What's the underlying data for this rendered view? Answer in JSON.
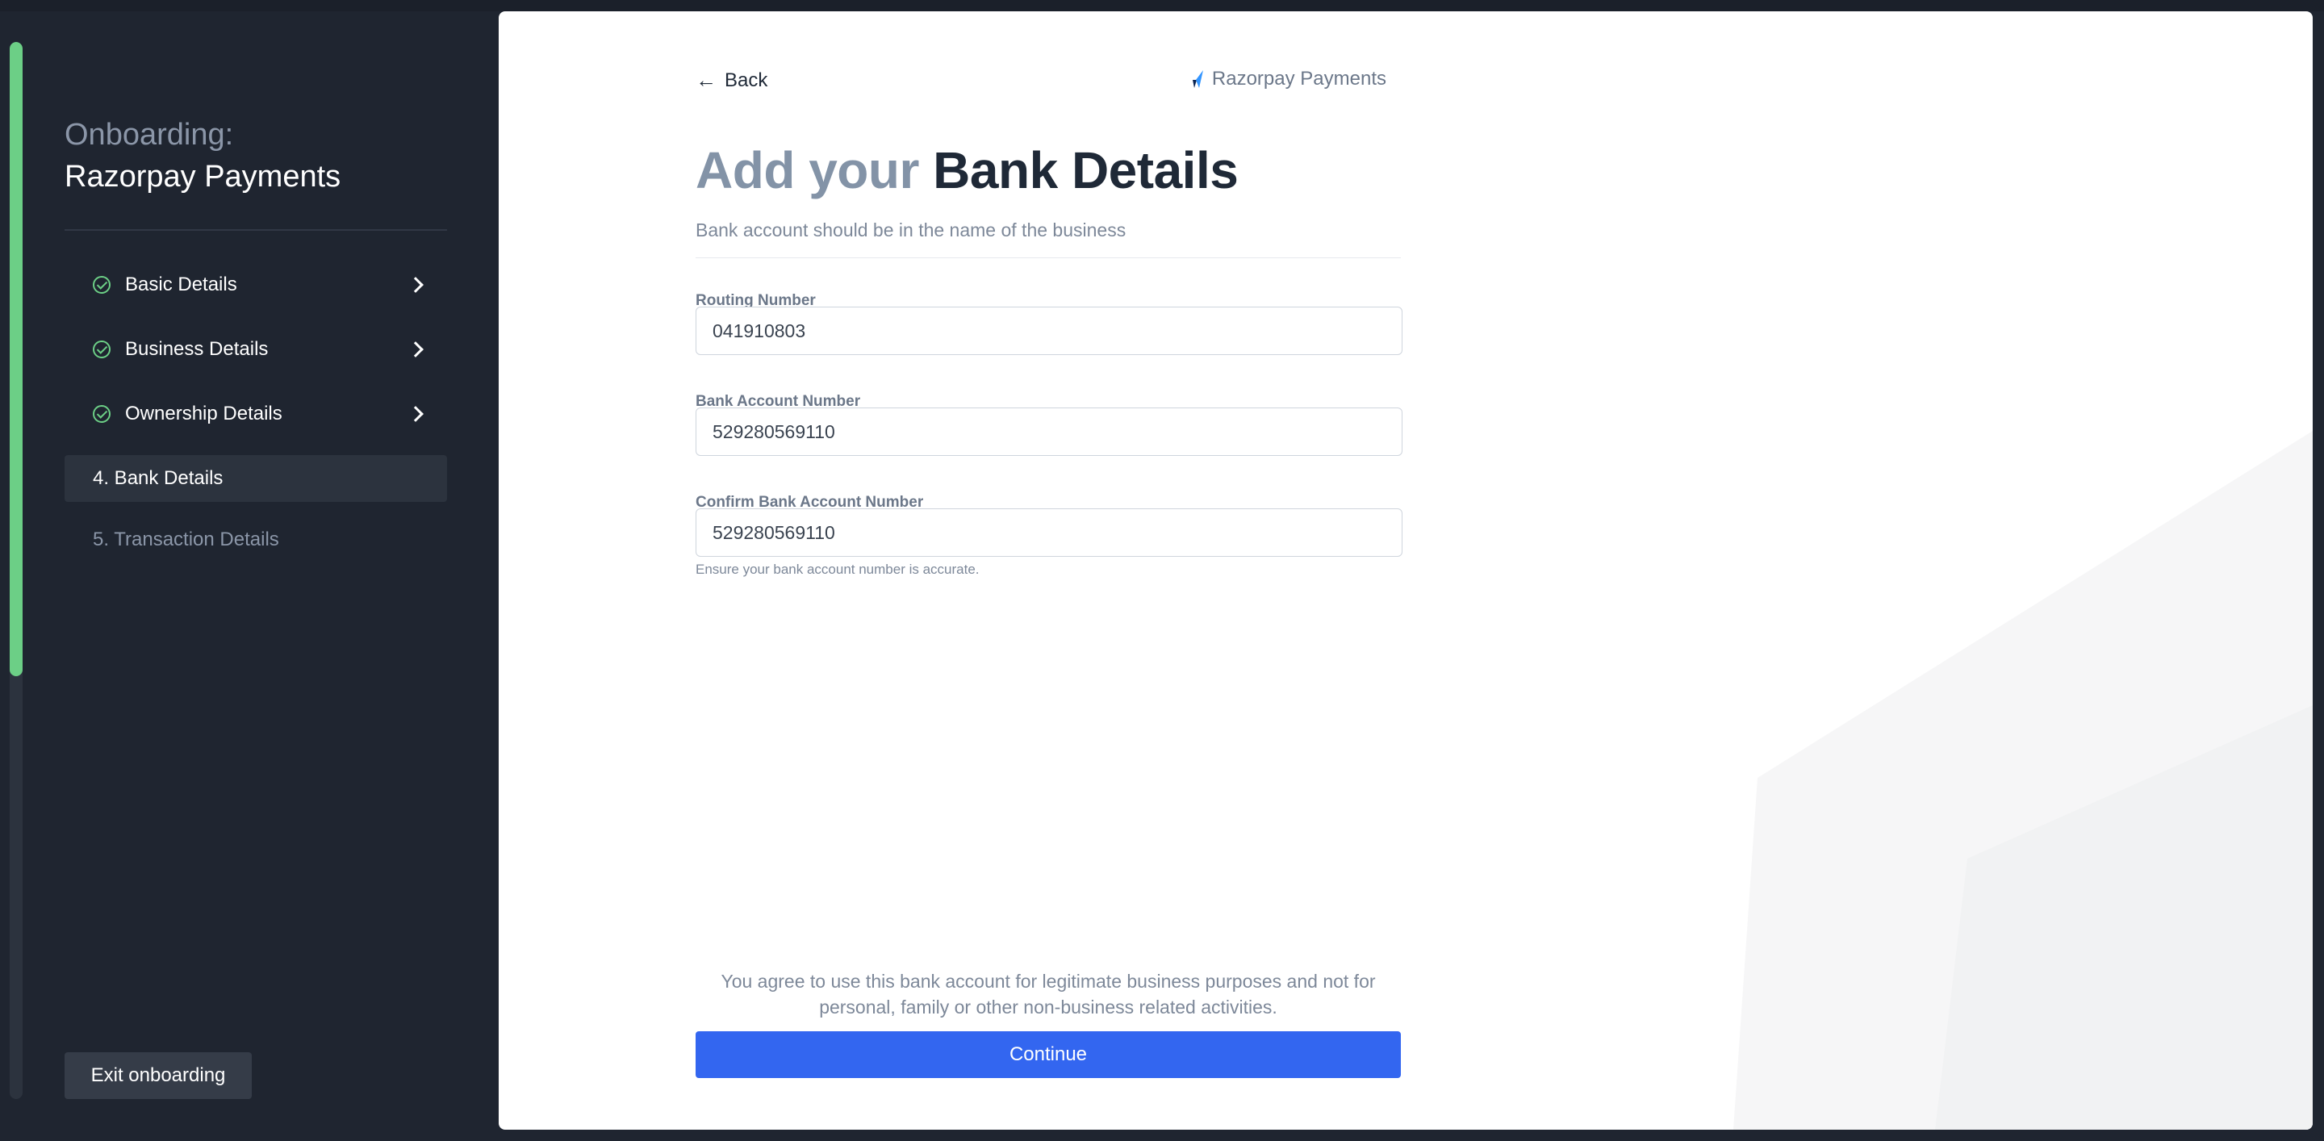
{
  "sidebar": {
    "onboarding_label": "Onboarding:",
    "onboarding_title": "Razorpay Payments",
    "progress_fraction": 0.6,
    "steps": [
      {
        "label": "Basic Details",
        "status": "complete"
      },
      {
        "label": "Business Details",
        "status": "complete"
      },
      {
        "label": "Ownership Details",
        "status": "complete"
      },
      {
        "label": "4. Bank Details",
        "status": "active"
      },
      {
        "label": "5. Transaction Details",
        "status": "upcoming"
      }
    ],
    "exit_label": "Exit onboarding"
  },
  "header": {
    "back_label": "Back",
    "brand_label": "Razorpay Payments"
  },
  "page": {
    "title_light": "Add your",
    "title_dark": "Bank Details",
    "subtitle": "Bank account should be in the name of the business"
  },
  "form": {
    "routing": {
      "label": "Routing Number",
      "value": "041910803"
    },
    "account": {
      "label": "Bank Account Number",
      "value": "529280569110"
    },
    "confirm": {
      "label": "Confirm Bank Account Number",
      "value": "529280569110"
    },
    "hint": "Ensure your bank account number is accurate."
  },
  "footer": {
    "agreement": "You agree to use this bank account for legitimate business purposes and not for personal, family or other non-business related activities.",
    "continue_label": "Continue"
  },
  "colors": {
    "sidebar_bg": "#1f2530",
    "progress": "#6ccf86",
    "accent": "#3366f0"
  },
  "icons": {
    "back": "arrow-left-icon",
    "brand": "razorpay-logo-icon",
    "check": "check-circle-icon",
    "chevron": "chevron-right-icon"
  }
}
